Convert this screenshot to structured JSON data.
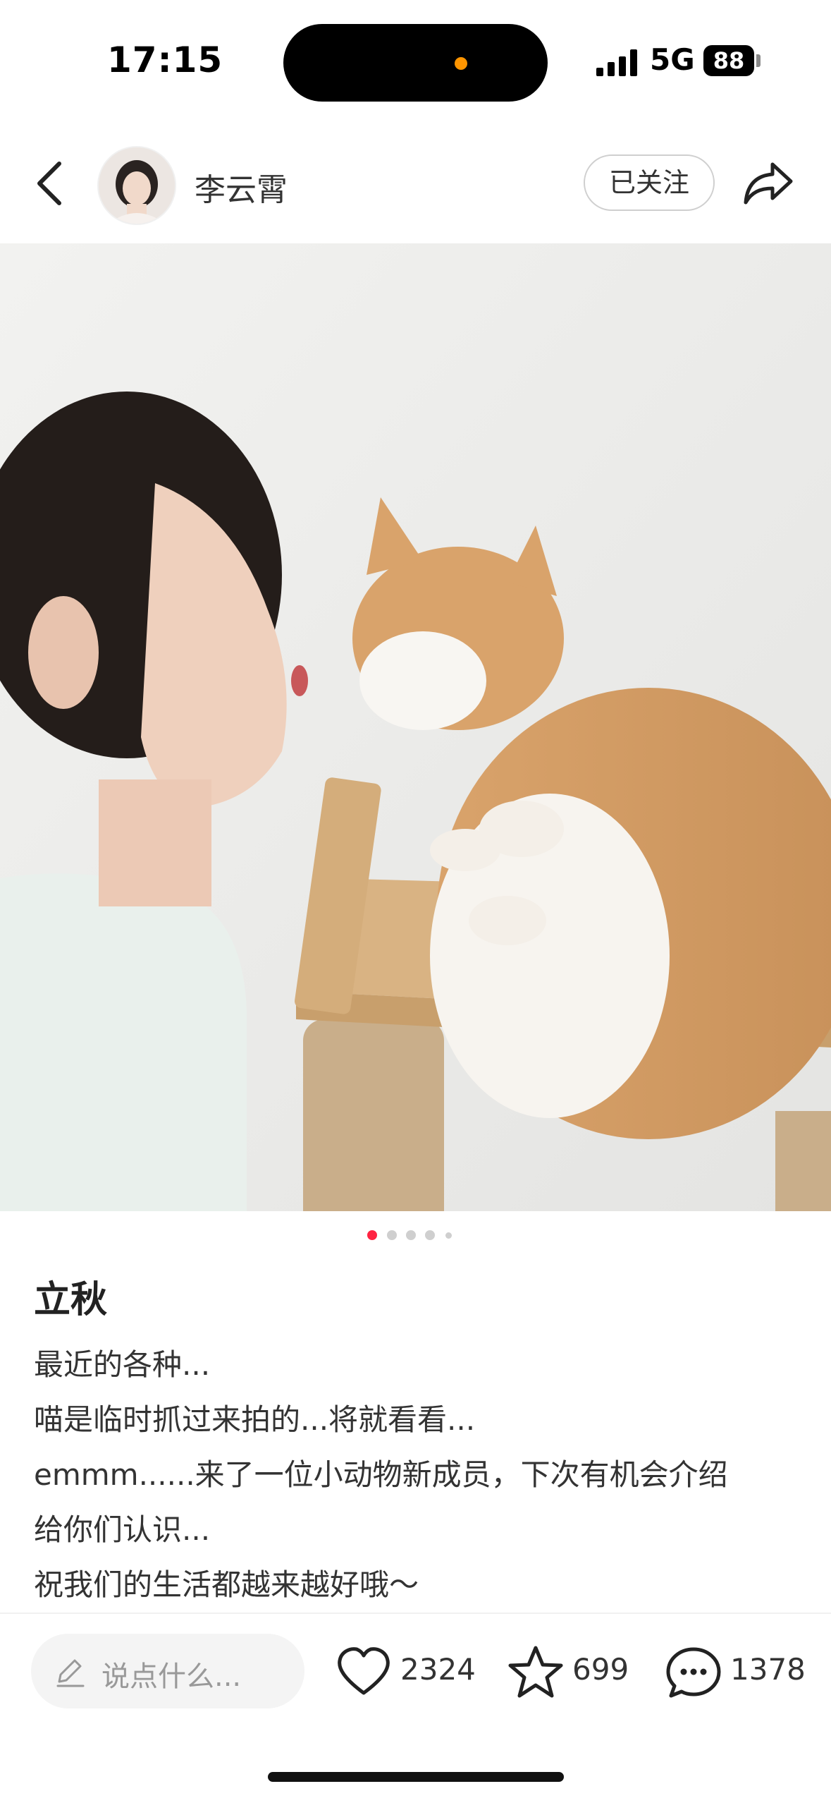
{
  "status_bar": {
    "time": "17:15",
    "network": "5G",
    "battery": "88"
  },
  "header": {
    "author_name": "李云霄",
    "follow_label": "已关注",
    "back_icon": "chevron-left-icon",
    "share_icon": "share-arrow-icon"
  },
  "carousel": {
    "total": 5,
    "current": 1,
    "active_color": "#ff2442"
  },
  "post": {
    "title": "立秋",
    "lines": [
      "最近的各种...",
      "喵是临时抓过来拍的...将就看看...",
      "emmm......来了一位小动物新成员，下次有机会介绍",
      "给你们认识...",
      "祝我们的生活都越来越好哦～"
    ]
  },
  "bottom_bar": {
    "comment_placeholder": "说点什么...",
    "likes": "2324",
    "favorites": "699",
    "comments": "1378"
  }
}
